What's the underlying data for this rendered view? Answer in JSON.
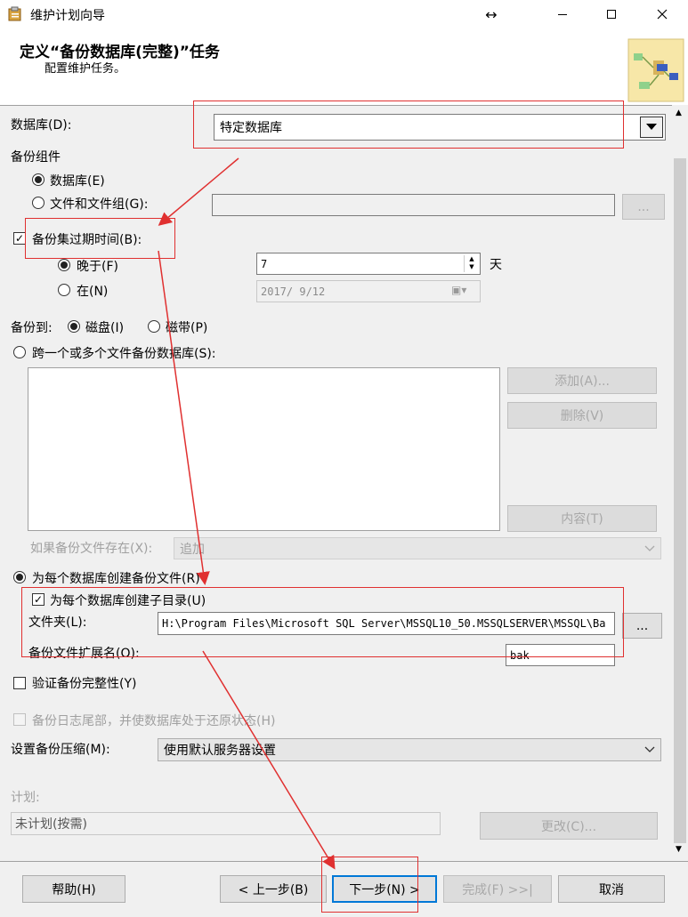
{
  "window": {
    "title": "维护计划向导"
  },
  "header": {
    "title": "定义“备份数据库(完整)”任务",
    "subtitle": "配置维护任务。"
  },
  "database": {
    "label": "数据库(D):",
    "value": "特定数据库"
  },
  "backup_component": {
    "label": "备份组件",
    "database_option": "数据库(E)",
    "files_option": "文件和文件组(G):",
    "browse_label": "..."
  },
  "expire": {
    "checkbox_label": "备份集过期时间(B):",
    "after_label": "晚于(F)",
    "after_value": "7",
    "days_unit": "天",
    "on_label": "在(N)",
    "on_value": "2017/ 9/12"
  },
  "backup_to": {
    "label": "备份到:",
    "disk_label": "磁盘(I)",
    "tape_label": "磁带(P)"
  },
  "span_files": {
    "label": "跨一个或多个文件备份数据库(S):",
    "add_button": "添加(A)...",
    "remove_button": "删除(V)",
    "contents_button": "内容(T)",
    "if_exists_label": "如果备份文件存在(X):",
    "if_exists_value": "追加"
  },
  "per_db": {
    "radio_label": "为每个数据库创建备份文件(R)",
    "subdir_label": "为每个数据库创建子目录(U)",
    "folder_label": "文件夹(L):",
    "folder_value": "H:\\Program Files\\Microsoft SQL Server\\MSSQL10_50.MSSQLSERVER\\MSSQL\\Ba",
    "folder_browse": "...",
    "ext_label": "备份文件扩展名(O):",
    "ext_value": "bak"
  },
  "verify": {
    "label": "验证备份完整性(Y)"
  },
  "tail_log": {
    "label": "备份日志尾部，并使数据库处于还原状态(H)"
  },
  "compression": {
    "label": "设置备份压缩(M):",
    "value": "使用默认服务器设置"
  },
  "schedule": {
    "label": "计划:",
    "value": "未计划(按需)",
    "change_button": "更改(C)..."
  },
  "footer": {
    "help": "帮助(H)",
    "back": "< 上一步(B)",
    "next": "下一步(N) >",
    "finish": "完成(F) >>|",
    "cancel": "取消"
  },
  "colors": {
    "annotation_red": "#e03030",
    "window_bg": "#f0f0f0"
  }
}
